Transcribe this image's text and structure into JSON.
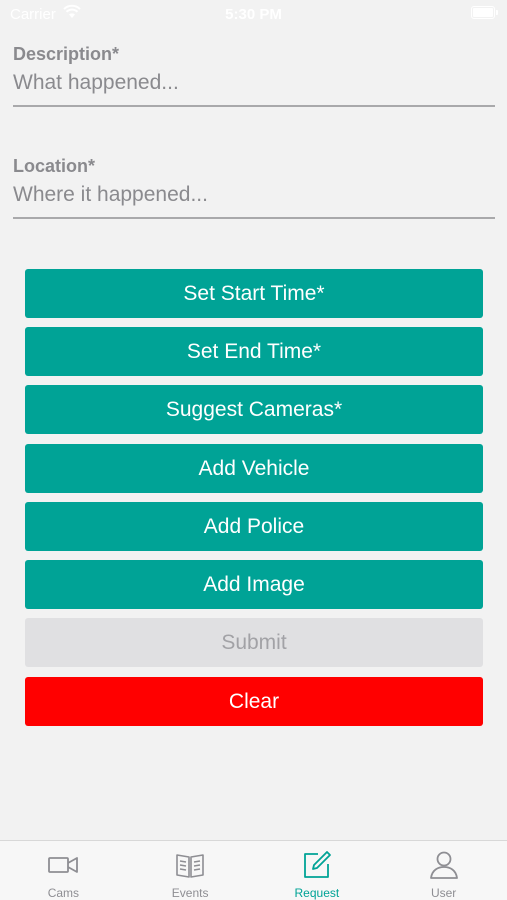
{
  "status_bar": {
    "carrier": "Carrier",
    "time": "5:30 PM"
  },
  "form": {
    "description": {
      "label": "Description*",
      "placeholder": "What happened...",
      "value": ""
    },
    "location": {
      "label": "Location*",
      "placeholder": "Where it happened...",
      "value": ""
    }
  },
  "buttons": {
    "set_start_time": "Set Start Time*",
    "set_end_time": "Set End Time*",
    "suggest_cameras": "Suggest Cameras*",
    "add_vehicle": "Add Vehicle",
    "add_police": "Add Police",
    "add_image": "Add Image",
    "submit": "Submit",
    "clear": "Clear"
  },
  "tab_bar": {
    "tabs": [
      {
        "label": "Cams",
        "icon": "video-camera-icon",
        "active": false
      },
      {
        "label": "Events",
        "icon": "book-icon",
        "active": false
      },
      {
        "label": "Request",
        "icon": "edit-icon",
        "active": true
      },
      {
        "label": "User",
        "icon": "user-icon",
        "active": false
      }
    ]
  },
  "colors": {
    "accent": "#00a396",
    "danger": "#ff0000",
    "disabled_bg": "#e0e0e2",
    "disabled_text": "#a2a2a6",
    "inactive_tab": "#8e8e93"
  }
}
